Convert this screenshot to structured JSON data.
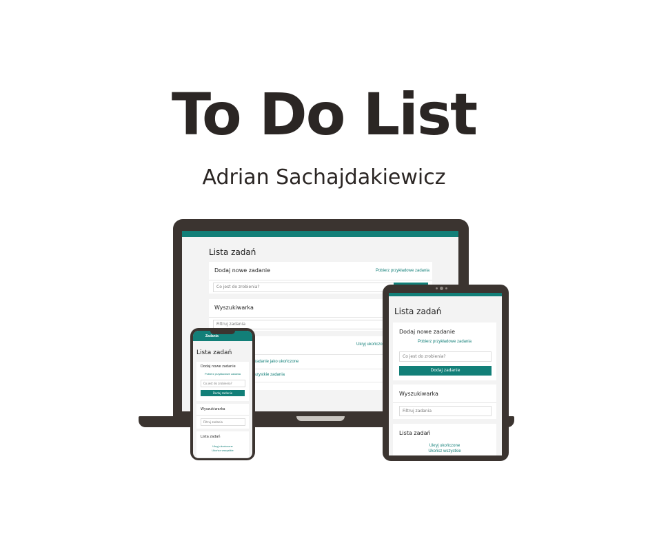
{
  "hero": {
    "title": "To Do List",
    "author": "Adrian Sachajdakiewicz"
  },
  "colors": {
    "accent": "#127f78",
    "device_frame": "#3b3430",
    "screen_bg": "#f3f3f3",
    "text_dark": "#2b2624"
  },
  "laptop": {
    "page_title": "Lista zadań",
    "add_card": {
      "heading": "Dodaj nowe zadanie",
      "sample_link": "Pobierz przykładowe zadania",
      "input_placeholder": "Co jest do zrobienia?"
    },
    "search_card": {
      "heading": "Wyszukiwarka",
      "input_placeholder": "Filtruj zadania"
    },
    "list_card": {
      "hide_completed": "Ukryj ukończone",
      "task_1": "zadanie jako ukończone",
      "task_2": "szystkie zadania"
    }
  },
  "tablet": {
    "page_title": "Lista zadań",
    "add_card": {
      "heading": "Dodaj nowe zadanie",
      "sample_link": "Pobierz przykładowe zadania",
      "input_placeholder": "Co jest do zrobienia?",
      "button": "Dodaj zadanie"
    },
    "search_card": {
      "heading": "Wyszukiwarka",
      "input_placeholder": "Filtruj zadania"
    },
    "list_card": {
      "heading": "Lista zadań",
      "hide_completed": "Ukryj ukończone",
      "complete_all": "Ukończ wszystkie"
    }
  },
  "phone": {
    "nav_title": "Zadania",
    "page_title": "Lista zadań",
    "add_card": {
      "heading": "Dodaj nowe zadanie",
      "sample_link": "Pobierz przykładowe zadania",
      "input_placeholder": "Co jest do zrobienia?",
      "button": "Dodaj zadanie"
    },
    "search_card": {
      "heading": "Wyszukiwarka",
      "input_placeholder": "Filtruj zadania"
    },
    "list_card": {
      "heading": "Lista zadań",
      "hide_completed": "Ukryj ukończone",
      "complete_all": "Ukończ wszystkie"
    }
  }
}
